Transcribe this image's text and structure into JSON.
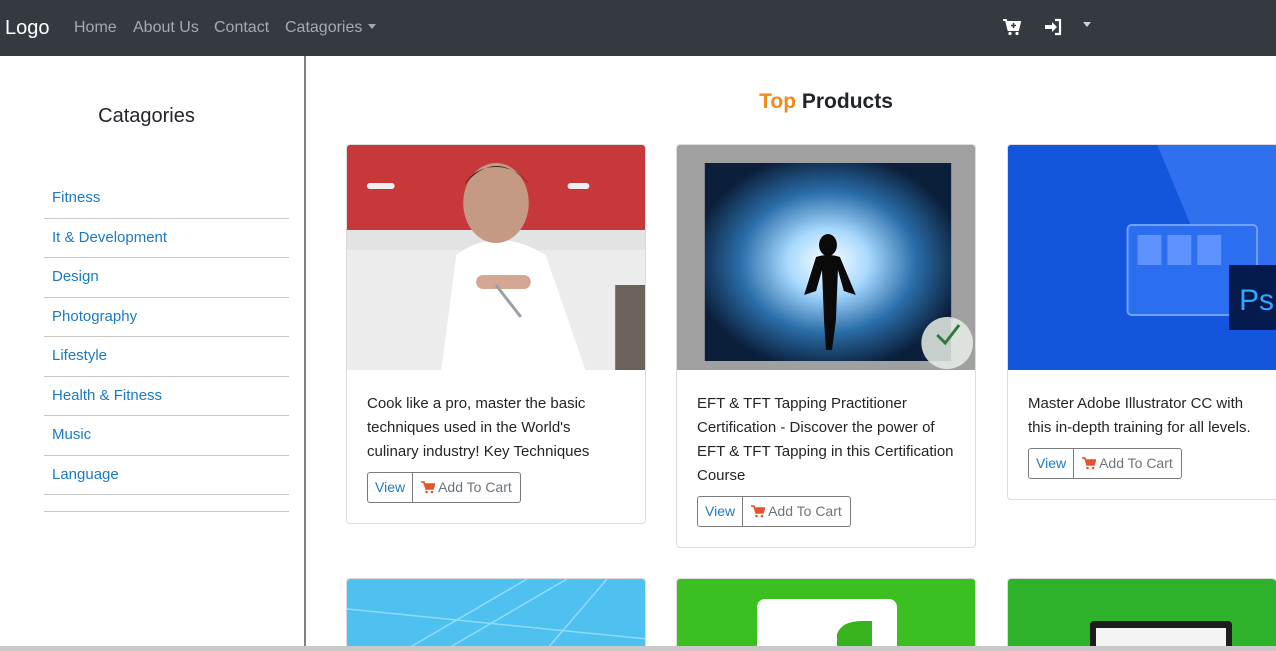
{
  "navbar": {
    "brand": "Logo",
    "links": [
      "Home",
      "About Us",
      "Contact"
    ],
    "dropdown_label": "Catagories",
    "icons": [
      "cart-plus-icon",
      "sign-in-icon",
      "user-dropdown-caret-icon"
    ]
  },
  "sidebar": {
    "title": "Catagories",
    "items": [
      "Fitness",
      "It & Development",
      "Design",
      "Photography",
      "Lifestyle",
      "Health & Fitness",
      "Music",
      "Language"
    ]
  },
  "main": {
    "title_accent": "Top",
    "title_rest": "Products",
    "products": [
      {
        "text": "Cook like a pro, master the basic techniques used in the World's culinary industry! Key Techniques",
        "view_label": "View",
        "cart_label": "Add To Cart",
        "image": "chef-holding-knife-photo"
      },
      {
        "text": "EFT & TFT Tapping Practitioner Certification - Discover the power of EFT & TFT Tapping in this Certification Course",
        "view_label": "View",
        "cart_label": "Add To Cart",
        "image": "glowing-human-silhouette-certified-badge"
      },
      {
        "text": "Master Adobe Illustrator CC with this in-depth training for all levels.",
        "view_label": "View",
        "cart_label": "Add To Cart",
        "image": "blue-designer-at-computer-ps-logo"
      }
    ],
    "second_row_images": [
      "light-blue-pattern",
      "green-app-icon",
      "green-laptop-screen"
    ]
  },
  "colors": {
    "navbar_bg": "#343a40",
    "accent_orange": "#f18a1c",
    "link_blue": "#1a7ac4"
  }
}
